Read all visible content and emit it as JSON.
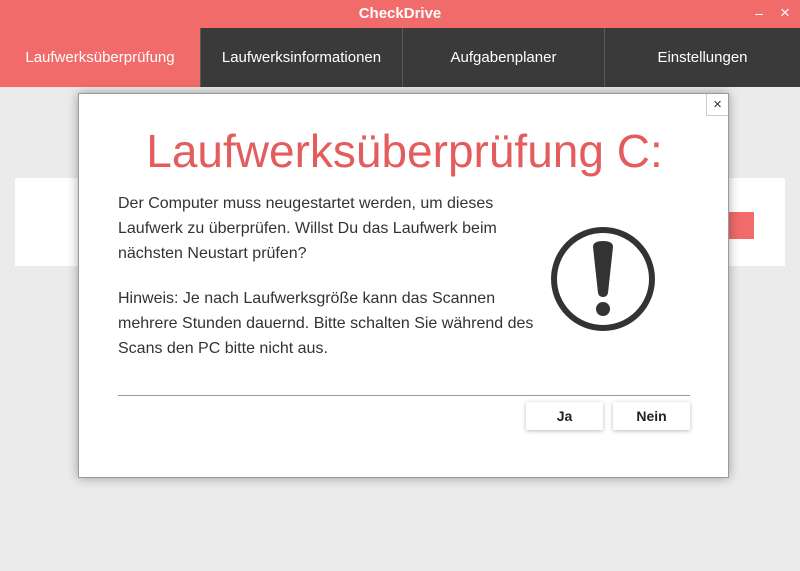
{
  "window": {
    "title": "CheckDrive",
    "minimize_glyph": "–",
    "close_glyph": "×"
  },
  "nav": {
    "tabs": [
      {
        "label": "Laufwerksüberprüfung",
        "active": true
      },
      {
        "label": "Laufwerksinformationen",
        "active": false
      },
      {
        "label": "Aufgabenplaner",
        "active": false
      },
      {
        "label": "Einstellungen",
        "active": false
      }
    ]
  },
  "dialog": {
    "title": "Laufwerksüberprüfung C:",
    "close_glyph": "×",
    "message": "Der Computer muss neugestartet werden, um dieses Laufwerk zu überprüfen. Willst Du das Laufwerk beim nächsten Neustart prüfen?",
    "note": "Hinweis: Je nach Laufwerksgröße kann das Scannen mehrere Stunden dauernd. Bitte schalten Sie während des Scans den PC bitte nicht aus.",
    "icon": "exclamation-circle-icon",
    "buttons": {
      "yes": "Ja",
      "no": "Nein"
    }
  },
  "colors": {
    "accent": "#f26b6b",
    "title_text": "#e35d5d",
    "nav_bg": "#3a3a3a",
    "app_bg": "#ebebeb"
  }
}
